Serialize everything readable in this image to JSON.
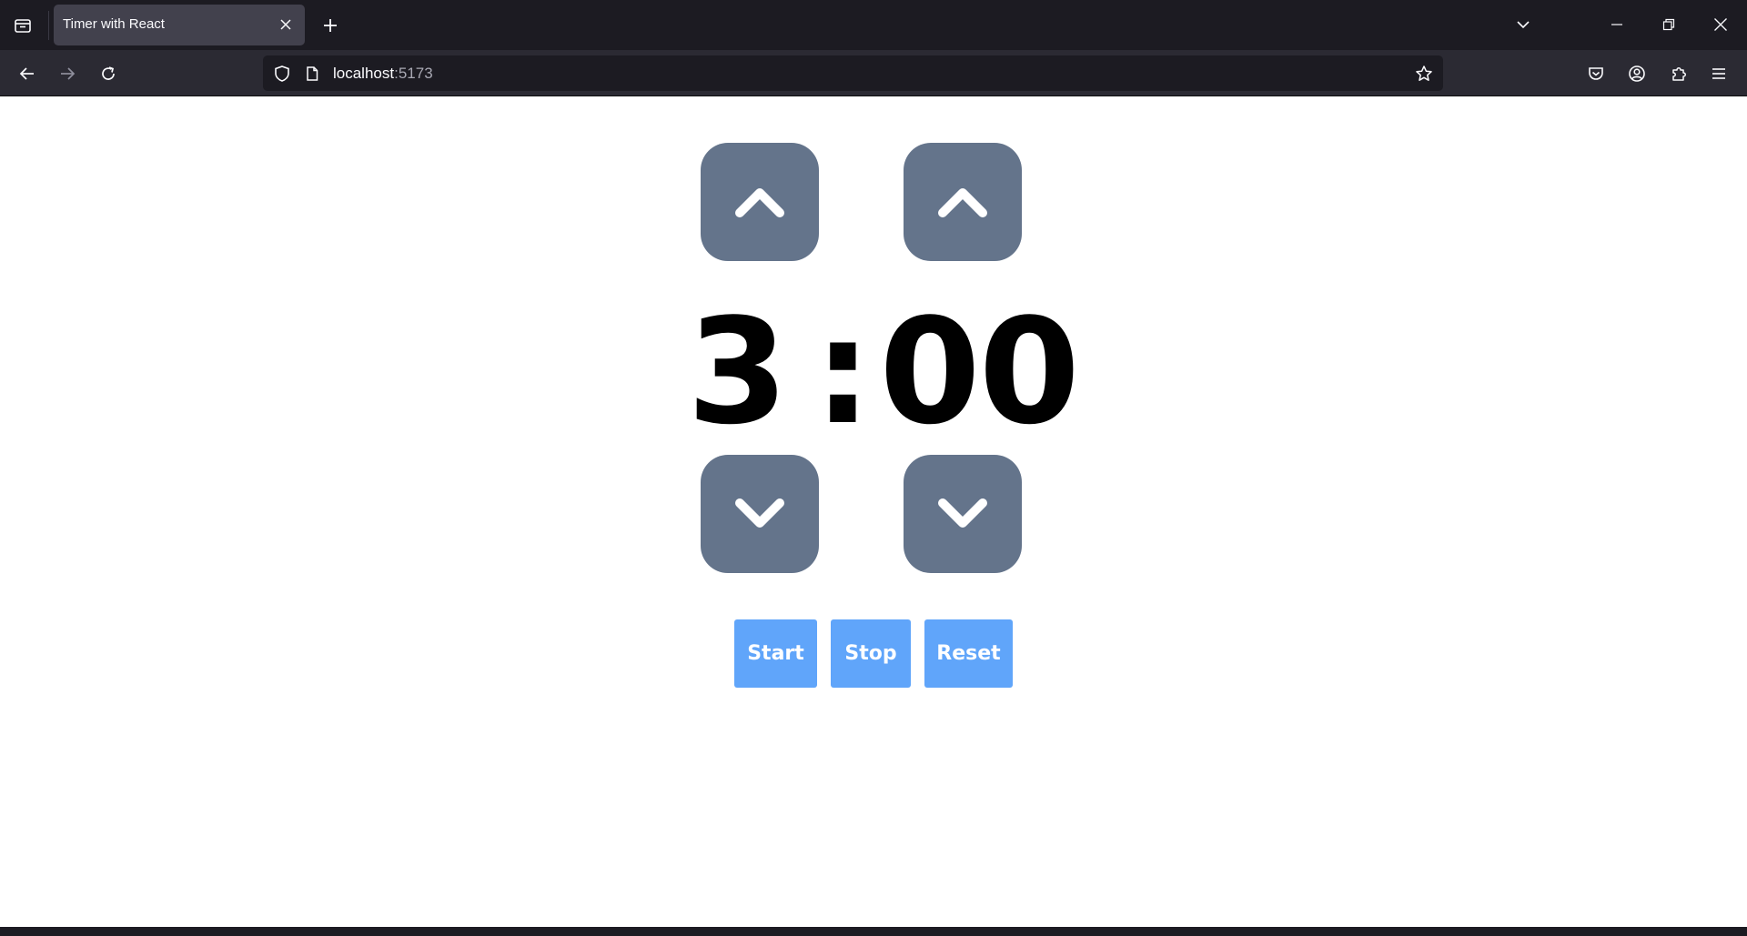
{
  "browser": {
    "tab": {
      "title": "Timer with React"
    },
    "url": {
      "host": "localhost",
      "port": ":5173"
    },
    "colors": {
      "tabstrip": "#1c1b22",
      "active_tab": "#42414d",
      "navbar": "#2b2a33",
      "urlbar": "#1c1b22"
    }
  },
  "timer": {
    "minutes": "3",
    "separator": ":",
    "seconds": "00"
  },
  "controls": {
    "minutes_up_icon": "chevron-up-icon",
    "seconds_up_icon": "chevron-up-icon",
    "minutes_down_icon": "chevron-down-icon",
    "seconds_down_icon": "chevron-down-icon"
  },
  "actions": {
    "start_label": "Start",
    "stop_label": "Stop",
    "reset_label": "Reset"
  },
  "colors": {
    "arrow_button": "#64748b",
    "action_button": "#60a5fa",
    "timer_text": "#000000"
  }
}
